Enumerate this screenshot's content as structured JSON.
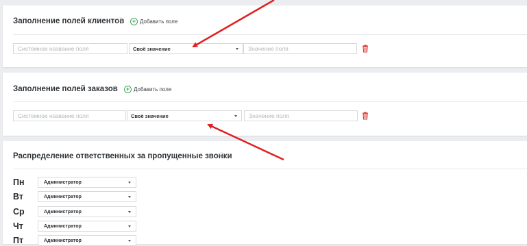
{
  "clients_section": {
    "title": "Заполнение полей клиентов",
    "add_label": "Добавить поле",
    "row": {
      "system_name_placeholder": "Системное название поля",
      "select_value": "Своё значение",
      "value_placeholder": "Значение поля"
    }
  },
  "orders_section": {
    "title": "Заполнение полей заказов",
    "add_label": "Добавить поле",
    "row": {
      "system_name_placeholder": "Системное название поля",
      "select_value": "Своё значение",
      "value_placeholder": "Значение поля"
    }
  },
  "missed_calls_section": {
    "title": "Распределение ответственных за пропущенные звонки",
    "days": [
      {
        "day": "Пн",
        "assignee": "Администратор"
      },
      {
        "day": "Вт",
        "assignee": "Администратор"
      },
      {
        "day": "Ср",
        "assignee": "Администратор"
      },
      {
        "day": "Чт",
        "assignee": "Администратор"
      },
      {
        "day": "Пт",
        "assignee": "Администратор"
      }
    ]
  },
  "icons": {
    "help": "help-icon",
    "add": "plus-circle-icon",
    "delete": "trash-icon",
    "dropdown": "caret-down-icon"
  },
  "colors": {
    "accent_green": "#3aa65a",
    "delete_red": "#e0312b",
    "annotation_arrow": "#e02020"
  }
}
